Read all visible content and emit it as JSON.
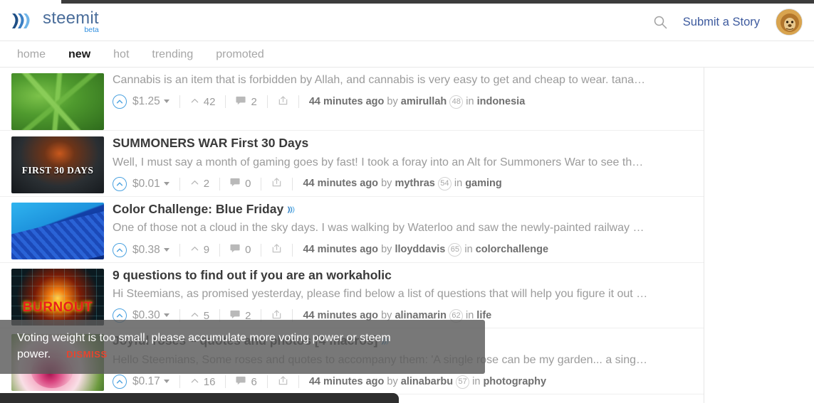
{
  "header": {
    "brand_name": "steemit",
    "brand_beta": "beta",
    "logo_icon": "steem-logo-icon",
    "search_icon": "search-icon",
    "submit_label": "Submit a Story",
    "avatar_icon": "user-avatar-lion"
  },
  "nav": {
    "items": [
      {
        "label": "home",
        "active": false
      },
      {
        "label": "new",
        "active": true
      },
      {
        "label": "hot",
        "active": false
      },
      {
        "label": "trending",
        "active": false
      },
      {
        "label": "promoted",
        "active": false
      }
    ]
  },
  "posts": [
    {
      "title": "",
      "summary": "Cannabis is an item that is forbidden by Allah, and cannabis is very easy to get and cheap to wear. tana…",
      "payout": "$1.25",
      "votes": "42",
      "comments": "2",
      "age": "44 minutes ago",
      "by_label": "by",
      "author": "amirullah",
      "reputation": "48",
      "in_label": "in",
      "category": "indonesia",
      "thumb": "th-cannabis",
      "thumb_text": ""
    },
    {
      "title": "SUMMONERS WAR First 30 Days",
      "summary": "Well, I must say a month of gaming goes by fast! I took a foray into an Alt for Summoners War to see th…",
      "payout": "$0.01",
      "votes": "2",
      "comments": "0",
      "age": "44 minutes ago",
      "by_label": "by",
      "author": "mythras",
      "reputation": "54",
      "in_label": "in",
      "category": "gaming",
      "thumb": "th-summoners",
      "thumb_text": "FIRST 30 DAYS"
    },
    {
      "title": "Color Challenge: Blue Friday",
      "title_has_glyph": true,
      "summary": "One of those not a cloud in the sky days. I was walking by Waterloo and saw the newly-painted railway …",
      "payout": "$0.38",
      "votes": "9",
      "comments": "0",
      "age": "44 minutes ago",
      "by_label": "by",
      "author": "lloyddavis",
      "reputation": "65",
      "in_label": "in",
      "category": "colorchallenge",
      "thumb": "th-blue",
      "thumb_text": ""
    },
    {
      "title": "9 questions to find out if you are an workaholic",
      "summary": "Hi Steemians, as promised yesterday, please find below a list of questions that will help you figure it out …",
      "payout": "$0.30",
      "votes": "5",
      "comments": "2",
      "age": "44 minutes ago",
      "by_label": "by",
      "author": "alinamarin",
      "reputation": "62",
      "in_label": "in",
      "category": "life",
      "thumb": "th-burnout",
      "thumb_text": "BURNOUT"
    },
    {
      "title": "Joyful roses – quotes and photos [4 macros]",
      "title_has_glyph": true,
      "summary": "Hello Steemians, Some roses and quotes to accompany them: 'A single rose can be my garden... a sing…",
      "payout": "$0.17",
      "votes": "16",
      "comments": "6",
      "age": "44 minutes ago",
      "by_label": "by",
      "author": "alinabarbu",
      "reputation": "57",
      "in_label": "in",
      "category": "photography",
      "thumb": "th-rose",
      "thumb_text": ""
    }
  ],
  "toast": {
    "message": "Voting weight is too small, please accumulate more voting power or steem power.",
    "dismiss_label": "DISMISS"
  },
  "colors": {
    "brand_blue": "#4a6d9a",
    "link_blue": "#3d5a9e",
    "beta_blue": "#2f8fe0",
    "upvote_blue": "#4ba2e0",
    "dismiss_red": "#e8442e",
    "toast_bg": "#5a5a5a"
  }
}
